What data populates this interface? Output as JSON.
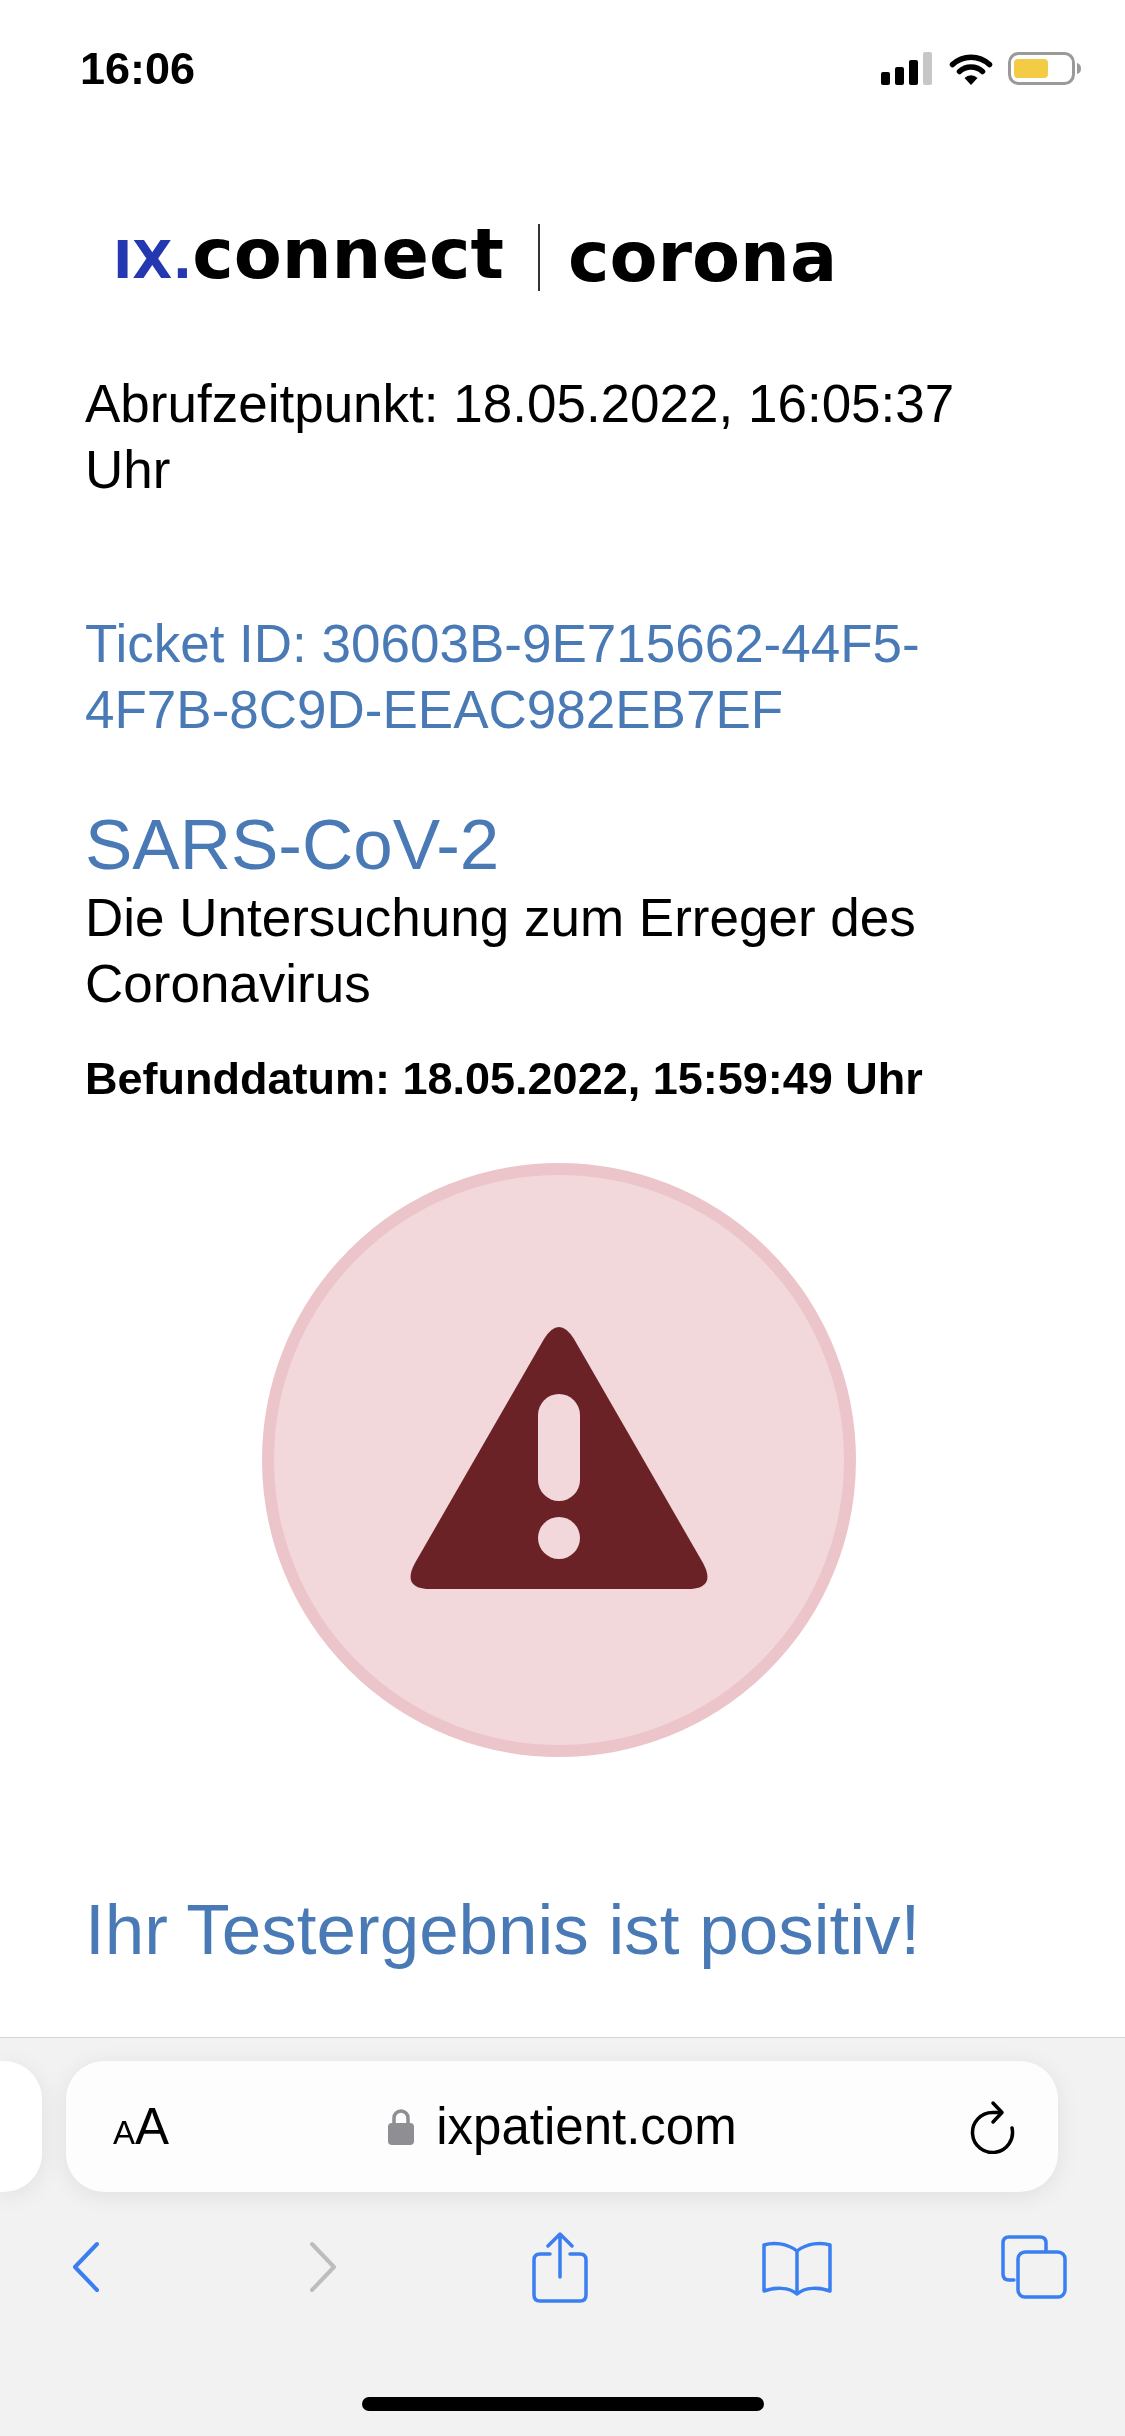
{
  "status_bar": {
    "time": "16:06"
  },
  "logo": {
    "prefix": "IX.",
    "name": "connect",
    "section": "corona"
  },
  "retrieval_time": "Abrufzeitpunkt: 18.05.2022, 16:05:37 Uhr",
  "ticket_id": "Ticket ID: 30603B-9E715662-44F5-4F7B-8C9D-EEAC982EB7EF",
  "test": {
    "title": "SARS-CoV-2",
    "description": "Die Untersuchung zum Erreger des Coronavirus",
    "result_date": "Befunddatum: 18.05.2022, 15:59:49 Uhr"
  },
  "result": {
    "kind": "warning",
    "message": "Ihr Testergebnis ist positiv!"
  },
  "browser": {
    "text_size_label": "AA",
    "secure": true,
    "url": "ixpatient.com",
    "toolbar": [
      {
        "kind": "back",
        "disabled": false
      },
      {
        "kind": "forward",
        "disabled": true
      },
      {
        "kind": "share",
        "disabled": false
      },
      {
        "kind": "bookmarks",
        "disabled": false
      },
      {
        "kind": "tabs",
        "disabled": false
      }
    ]
  }
}
